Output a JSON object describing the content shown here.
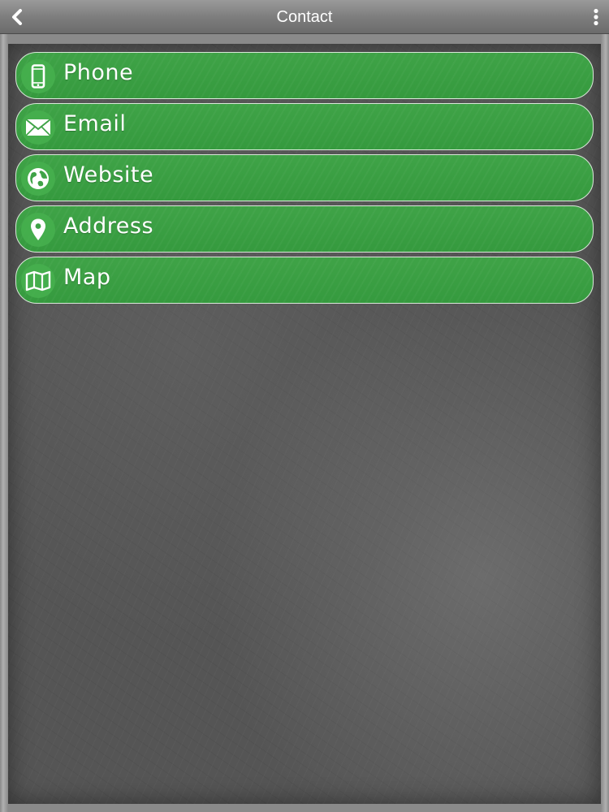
{
  "header": {
    "title": "Contact",
    "back_icon": "chevron-left-icon",
    "menu_icon": "more-vertical-icon"
  },
  "contact_items": [
    {
      "label": "Phone",
      "icon": "phone-icon"
    },
    {
      "label": "Email",
      "icon": "envelope-icon"
    },
    {
      "label": "Website",
      "icon": "globe-icon"
    },
    {
      "label": "Address",
      "icon": "map-pin-icon"
    },
    {
      "label": "Map",
      "icon": "map-icon"
    }
  ],
  "colors": {
    "item_green": "#3fa347",
    "header_gray": "#7e7e7e",
    "background_gray": "#555555"
  }
}
